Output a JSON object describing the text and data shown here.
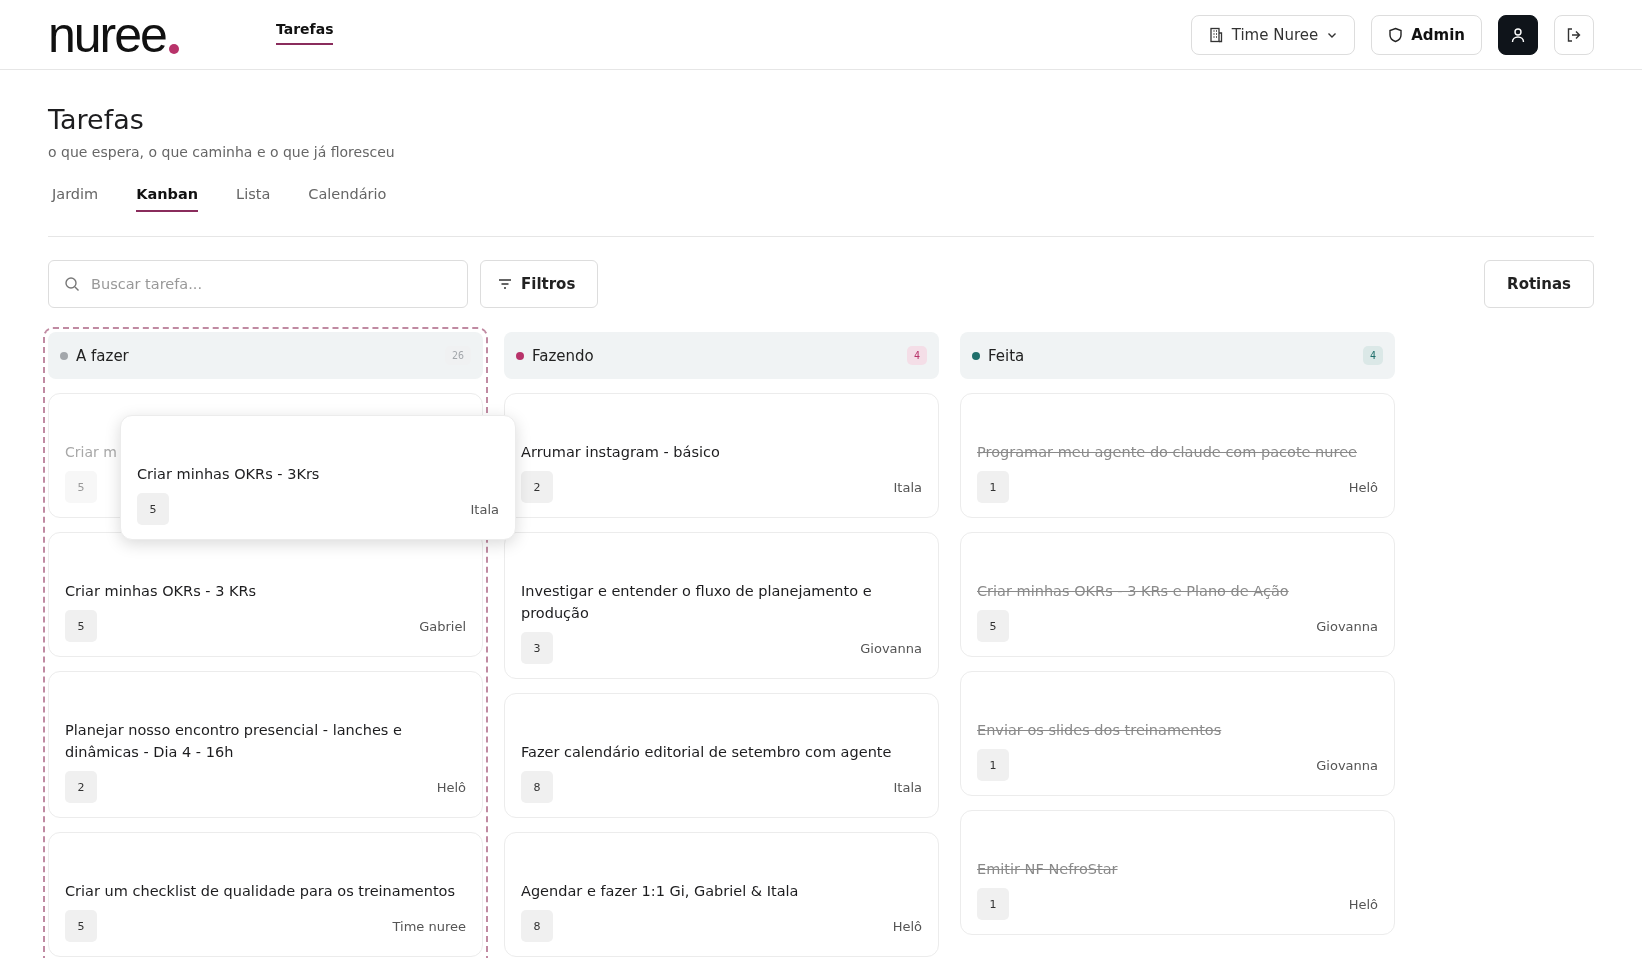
{
  "header": {
    "logo": "nuree",
    "nav": [
      {
        "label": "Tarefas",
        "selected": true
      }
    ],
    "team_button": "Time Nuree",
    "admin_button": "Admin"
  },
  "page": {
    "title": "Tarefas",
    "subtitle": "o que espera, o que caminha e o que já floresceu"
  },
  "tabs": [
    {
      "label": "Jardim",
      "selected": false
    },
    {
      "label": "Kanban",
      "selected": true
    },
    {
      "label": "Lista",
      "selected": false
    },
    {
      "label": "Calendário",
      "selected": false
    }
  ],
  "toolbar": {
    "search": {
      "placeholder": "Buscar tarefa..."
    },
    "filters_button": "Filtros",
    "routines_button": "Rotinas"
  },
  "columns": [
    {
      "name": "A fazer",
      "color": "#a3a7ab",
      "count": "26",
      "drop_target": true,
      "cards": [
        {
          "title": "Criar m",
          "points": "5",
          "done": false,
          "placeholder": true
        },
        {
          "title": "Criar minhas OKRs - 3 KRs",
          "points": "5",
          "assignee": "Gabriel",
          "done": false,
          "placeholder": false
        },
        {
          "title": "Planejar nosso encontro presencial - lanches e dinâmicas - Dia 4 - 16h",
          "points": "2",
          "assignee": "Helô",
          "done": false,
          "placeholder": false
        },
        {
          "title": "Criar um checklist de qualidade para os treinamentos",
          "points": "5",
          "assignee": "Time nuree",
          "done": false,
          "placeholder": false
        }
      ]
    },
    {
      "name": "Fazendo",
      "color": "#b8336a",
      "count": "4",
      "drop_target": false,
      "cards": [
        {
          "title": "Arrumar instagram - básico",
          "points": "2",
          "assignee": "Itala",
          "done": false,
          "placeholder": false
        },
        {
          "title": "Investigar e entender o fluxo de planejamento e produção",
          "points": "3",
          "assignee": "Giovanna",
          "done": false,
          "placeholder": false
        },
        {
          "title": "Fazer calendário editorial de setembro com agente",
          "points": "8",
          "assignee": "Itala",
          "done": false,
          "placeholder": false
        },
        {
          "title": "Agendar e fazer 1:1 Gi, Gabriel & Itala",
          "points": "8",
          "assignee": "Helô",
          "done": false,
          "placeholder": false
        }
      ]
    },
    {
      "name": "Feita",
      "color": "#1f6f6b",
      "count": "4",
      "drop_target": false,
      "cards": [
        {
          "title": "Programar meu agente do claude com pacote nuree",
          "points": "1",
          "assignee": "Helô",
          "done": true,
          "placeholder": false
        },
        {
          "title": "Criar minhas OKRs - 3 KRs e Plano de Ação",
          "points": "5",
          "assignee": "Giovanna",
          "done": true,
          "placeholder": false
        },
        {
          "title": "Enviar os slides dos treinamentos",
          "points": "1",
          "assignee": "Giovanna",
          "done": true,
          "placeholder": false
        },
        {
          "title": "Emitir NF NefroStar",
          "points": "1",
          "assignee": "Helô",
          "done": true,
          "placeholder": false
        }
      ]
    }
  ],
  "dragging_card": {
    "title": "Criar minhas OKRs - 3Krs",
    "points": "5",
    "assignee": "Itala"
  }
}
